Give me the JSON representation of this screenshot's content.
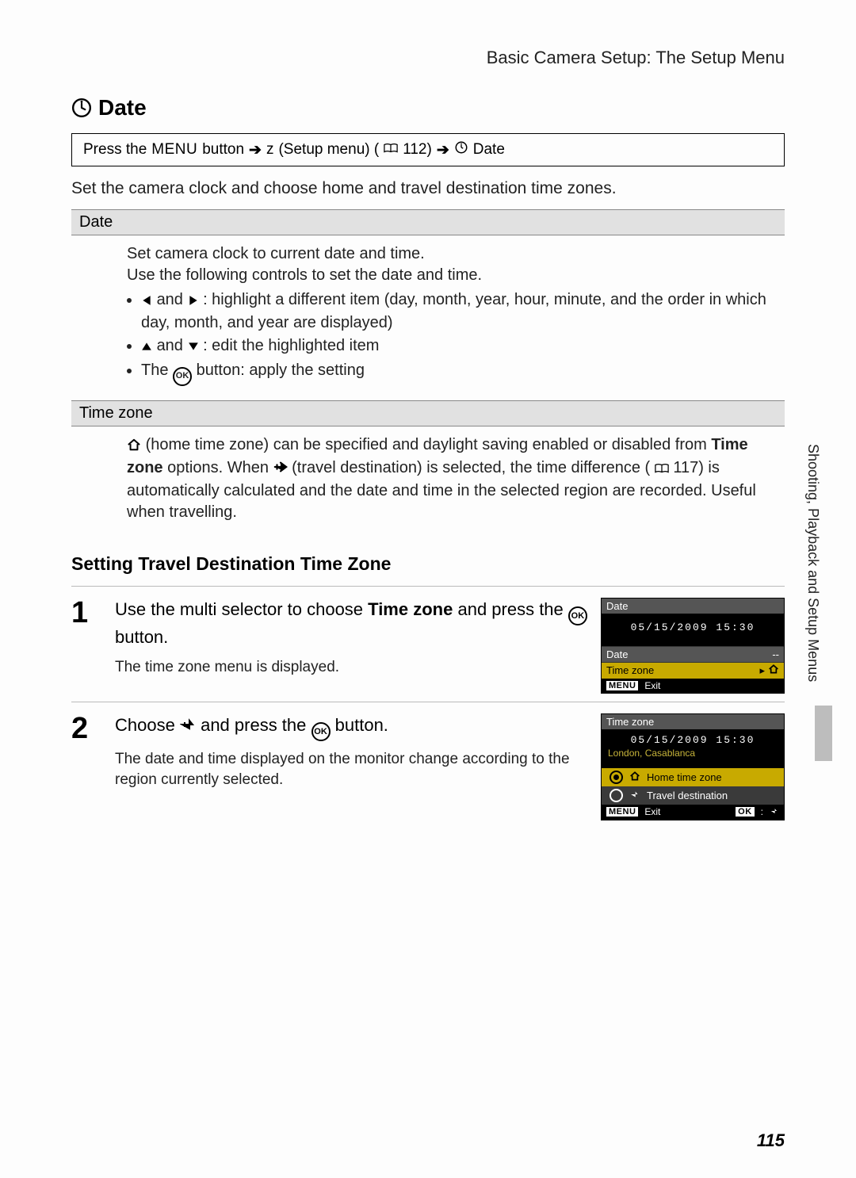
{
  "breadcrumb": "Basic Camera Setup: The Setup Menu",
  "heading": "Date",
  "nav": {
    "press_the": "Press the",
    "menu_word": "MENU",
    "button_word": "button",
    "arrow": "➔",
    "z": "z",
    "setup_menu": "(Setup menu) (",
    "page_ref": " 112)",
    "date_word": "Date"
  },
  "intro": "Set the camera clock and choose home and travel destination time zones.",
  "rows": {
    "date_label": "Date",
    "date_body1": "Set camera clock to current date and time.",
    "date_body2": "Use the following controls to set the date and time.",
    "date_b1_mid": " and ",
    "date_b1_tail": ": highlight a different item (day, month, year, hour, minute, and the order in which day, month, and year are displayed)",
    "date_b2_tail": ": edit the highlighted item",
    "date_b3_pre": "The ",
    "date_b3_post": " button: apply the setting",
    "tz_label": "Time zone",
    "tz_text1a": " (home time zone) can be specified and daylight saving enabled or disabled from ",
    "tz_text1b": "Time zone",
    "tz_text1c": " options. When ",
    "tz_text1d": " (travel destination) is selected, the time difference (",
    "tz_text1e": " 117) is automatically calculated and the date and time in the selected region are recorded. Useful when travelling."
  },
  "h2": "Setting Travel Destination Time Zone",
  "steps": {
    "s1": {
      "num": "1",
      "t_pre": "Use the multi selector to choose ",
      "t_bold": "Time zone",
      "t_mid": " and press the ",
      "t_post": " button.",
      "note": "The time zone menu is displayed."
    },
    "s2": {
      "num": "2",
      "t_pre": "Choose ",
      "t_mid": " and press the ",
      "t_post": " button.",
      "note": "The date and time displayed on the monitor change according to the region currently selected."
    }
  },
  "lcd1": {
    "title": "Date",
    "datetime": "05/15/2009  15:30",
    "row_date": "Date",
    "row_tz": "Time zone",
    "exit": "Exit",
    "menu": "MENU"
  },
  "lcd2": {
    "title": "Time zone",
    "datetime": "05/15/2009  15:30",
    "loc": "London, Casablanca",
    "opt_home": "Home time zone",
    "opt_travel": "Travel destination",
    "exit": "Exit",
    "menu": "MENU",
    "ok": "OK"
  },
  "side": "Shooting, Playback and Setup Menus",
  "page_no": "115"
}
